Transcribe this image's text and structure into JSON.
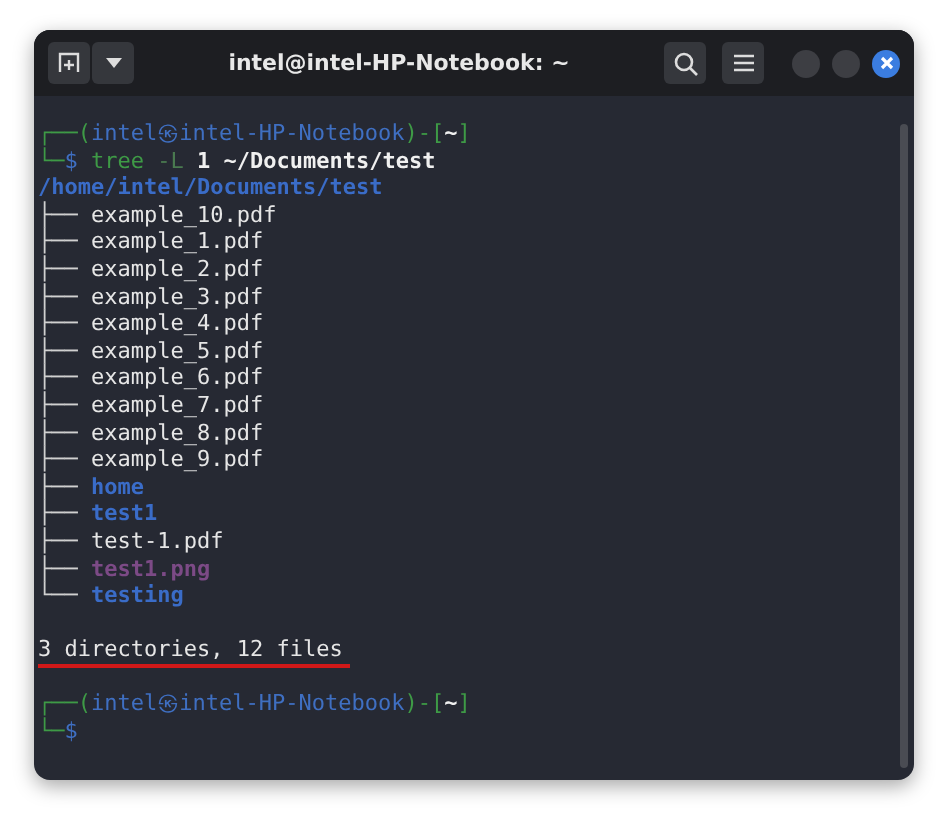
{
  "window": {
    "title": "intel@intel-HP-Notebook: ~"
  },
  "terminal": {
    "lines": [
      {
        "kind": "prompt",
        "parts": [
          {
            "text": "┌──(",
            "kind": "frame"
          },
          {
            "text": "intel㉿intel-HP-Notebook",
            "kind": "user"
          },
          {
            "text": ")-[",
            "kind": "frame"
          },
          {
            "text": "~",
            "kind": "plain"
          },
          {
            "text": "]",
            "kind": "frame"
          }
        ]
      },
      {
        "kind": "command",
        "parts": [
          {
            "text": "└─",
            "kind": "frame"
          },
          {
            "text": "$ ",
            "kind": "user"
          },
          {
            "text": "tree",
            "kind": "frame"
          },
          {
            "text": " -L",
            "kind": "option"
          },
          {
            "text": " 1 ~/Documents/test",
            "kind": "plain"
          }
        ]
      },
      {
        "kind": "path",
        "text": "/home/intel/Documents/test"
      },
      {
        "kind": "file",
        "branch": "├──",
        "name": "example_10.pdf"
      },
      {
        "kind": "file",
        "branch": "├──",
        "name": "example_1.pdf"
      },
      {
        "kind": "file",
        "branch": "├──",
        "name": "example_2.pdf"
      },
      {
        "kind": "file",
        "branch": "├──",
        "name": "example_3.pdf"
      },
      {
        "kind": "file",
        "branch": "├──",
        "name": "example_4.pdf"
      },
      {
        "kind": "file",
        "branch": "├──",
        "name": "example_5.pdf"
      },
      {
        "kind": "file",
        "branch": "├──",
        "name": "example_6.pdf"
      },
      {
        "kind": "file",
        "branch": "├──",
        "name": "example_7.pdf"
      },
      {
        "kind": "file",
        "branch": "├──",
        "name": "example_8.pdf"
      },
      {
        "kind": "file",
        "branch": "├──",
        "name": "example_9.pdf"
      },
      {
        "kind": "dir",
        "branch": "├──",
        "name": "home"
      },
      {
        "kind": "dir",
        "branch": "├──",
        "name": "test1"
      },
      {
        "kind": "file",
        "branch": "├──",
        "name": "test-1.pdf"
      },
      {
        "kind": "image",
        "branch": "├──",
        "name": "test1.png"
      },
      {
        "kind": "dir",
        "branch": "└──",
        "name": "testing"
      },
      {
        "kind": "blank"
      },
      {
        "kind": "summary",
        "text": "3 directories, 12 files",
        "underlined": true
      },
      {
        "kind": "blank"
      },
      {
        "kind": "prompt",
        "parts": [
          {
            "text": "┌──(",
            "kind": "frame"
          },
          {
            "text": "intel㉿intel-HP-Notebook",
            "kind": "user"
          },
          {
            "text": ")-[",
            "kind": "frame"
          },
          {
            "text": "~",
            "kind": "plain"
          },
          {
            "text": "]",
            "kind": "frame"
          }
        ]
      },
      {
        "kind": "command",
        "parts": [
          {
            "text": "└─",
            "kind": "frame"
          },
          {
            "text": "$",
            "kind": "user"
          }
        ]
      }
    ]
  }
}
